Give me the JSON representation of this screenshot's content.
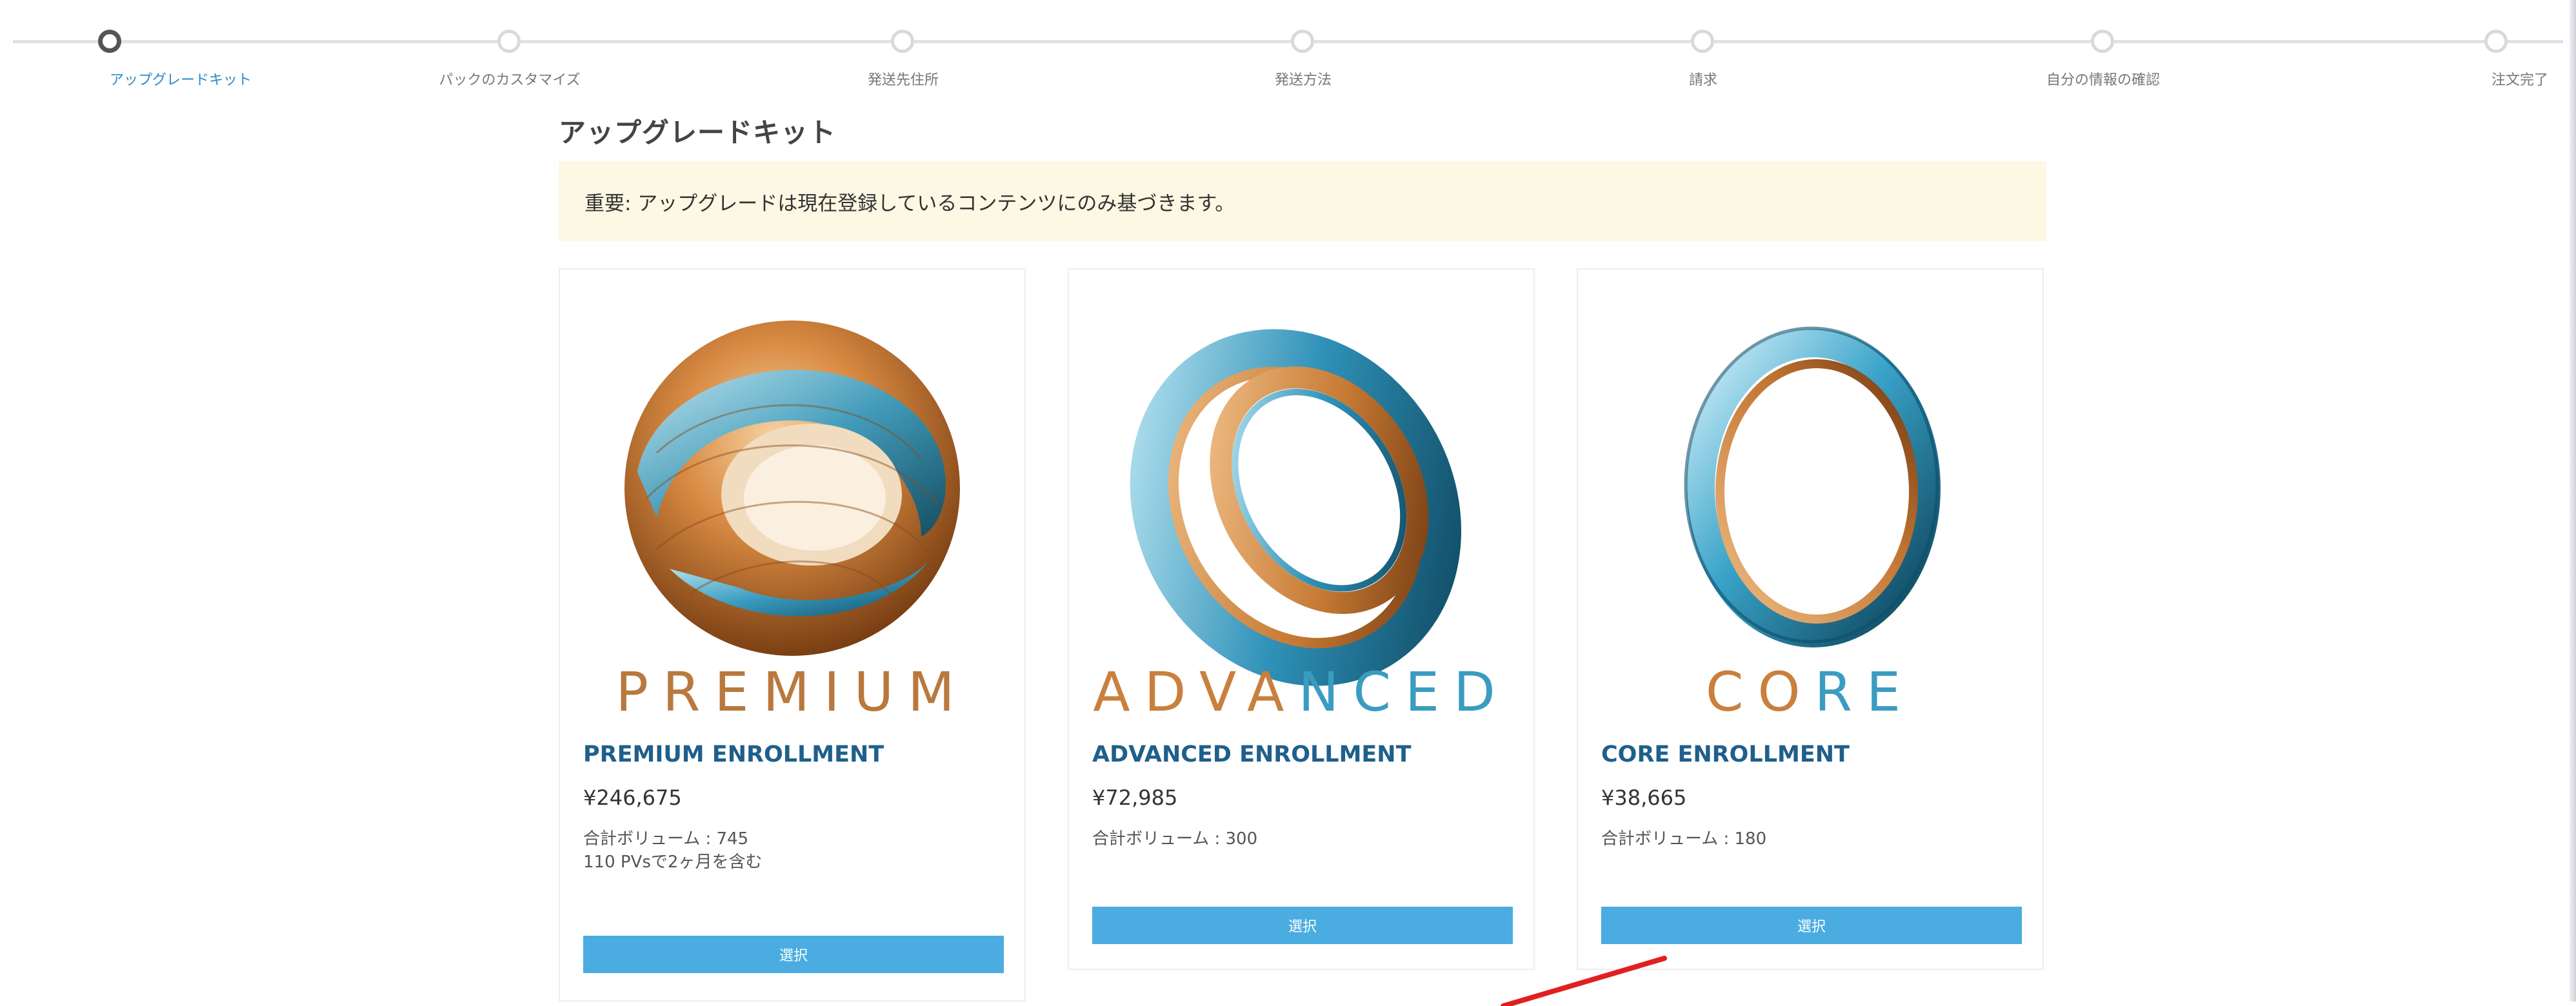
{
  "stepper": {
    "steps": [
      {
        "label": "アップグレードキット",
        "active": true
      },
      {
        "label": "パックのカスタマイズ",
        "active": false
      },
      {
        "label": "発送先住所",
        "active": false
      },
      {
        "label": "発送方法",
        "active": false
      },
      {
        "label": "請求",
        "active": false
      },
      {
        "label": "自分の情報の確認",
        "active": false
      },
      {
        "label": "注文完了",
        "active": false
      }
    ]
  },
  "page": {
    "title": "アップグレードキット",
    "notice": "重要: アップグレードは現在登録しているコンテンツにのみ基づきます。"
  },
  "cards": [
    {
      "logo_text": "PREMIUM",
      "title": "PREMIUM ENROLLMENT",
      "price": "¥246,675",
      "volume": "合計ボリューム : 745",
      "note": "110 PVsで2ヶ月を含む",
      "button": "選択"
    },
    {
      "logo_text": "ADVANCED",
      "title": "ADVANCED ENROLLMENT",
      "price": "¥72,985",
      "volume": "合計ボリューム : 300",
      "note": "",
      "button": "選択"
    },
    {
      "logo_text": "CORE",
      "title": "CORE ENROLLMENT",
      "price": "¥38,665",
      "volume": "合計ボリューム : 180",
      "note": "",
      "button": "選択"
    }
  ],
  "colors": {
    "accent": "#4aace0",
    "active_step": "#2d89c8",
    "card_title": "#1f5f8b",
    "notice_bg": "#fdf8e4",
    "copper": "#c9803e",
    "teal": "#3a9cc0",
    "annotation": "#e02020"
  }
}
